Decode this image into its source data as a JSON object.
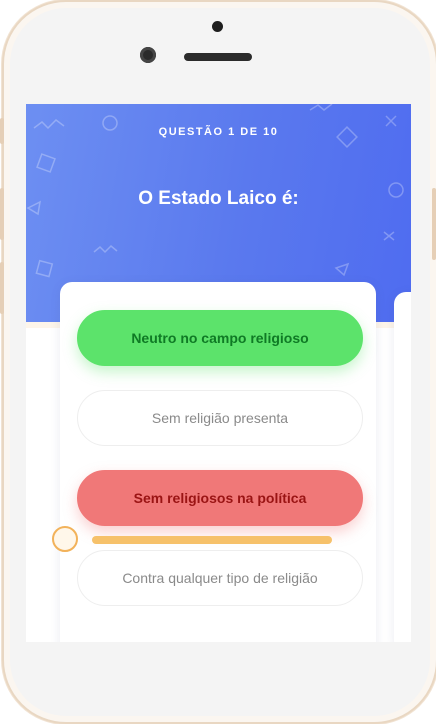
{
  "quiz": {
    "progress_label": "QUESTÃO 1 DE 10",
    "question": "O Estado Laico é:",
    "options": [
      {
        "label": "Neutro no campo religioso",
        "state": "correct"
      },
      {
        "label": "Sem religião presenta",
        "state": "neutral"
      },
      {
        "label": "Sem religiosos na política",
        "state": "wrong"
      },
      {
        "label": "Contra qualquer tipo de religião",
        "state": "neutral"
      }
    ]
  },
  "colors": {
    "header_gradient_start": "#6d8ff2",
    "header_gradient_end": "#4f6cf0",
    "correct": "#5ce36b",
    "wrong": "#f07878",
    "timer": "#f6c16a"
  },
  "icons": {
    "timer": "stopwatch-icon",
    "decorations": [
      "circle-outline",
      "square-outline",
      "triangle-outline",
      "zigzag",
      "x-mark"
    ]
  }
}
